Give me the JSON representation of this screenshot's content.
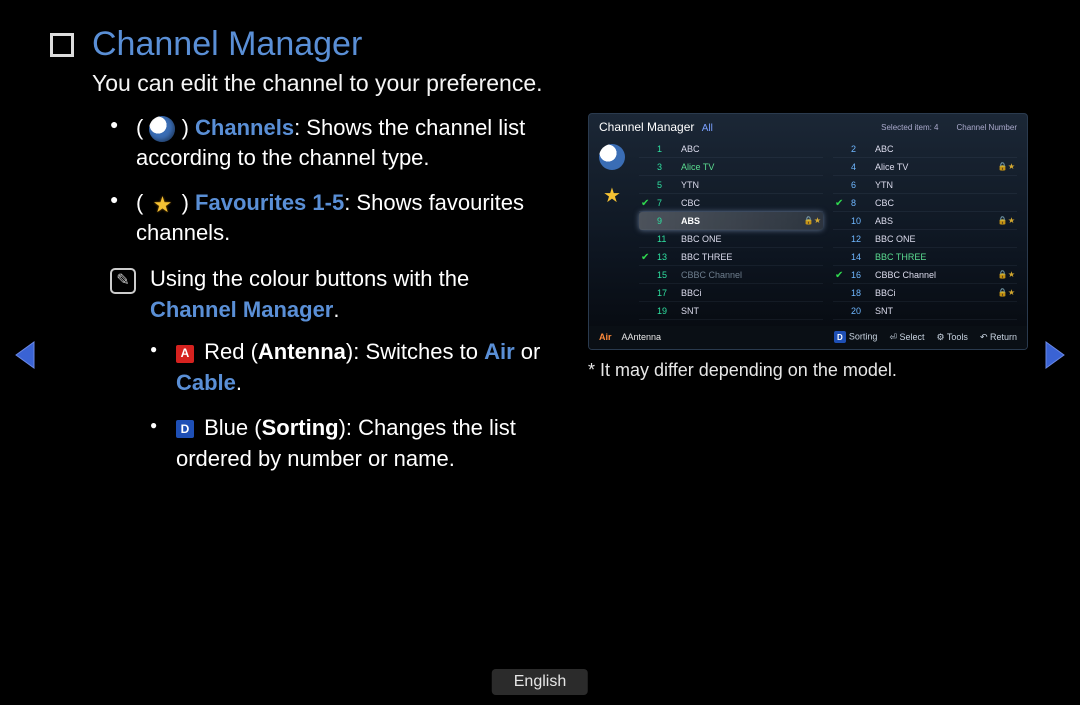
{
  "page": {
    "title": "Channel Manager",
    "subtitle": "You can edit the channel to your preference.",
    "language": "English"
  },
  "list": {
    "channels_label": "Channels",
    "channels_desc_before": "(",
    "channels_desc_after": "): Shows the channel list according to the channel type.",
    "favourites_label": "Favourites 1-5",
    "favourites_desc_before": "(",
    "favourites_desc_after": "): Shows favourites channels."
  },
  "note": {
    "intro": "Using the colour buttons with the ",
    "cm": "Channel Manager",
    "dot": ".",
    "red_key": "A",
    "red_pre": " Red (",
    "red_label": "Antenna",
    "red_mid": "): Switches to ",
    "red_air": "Air",
    "red_or": " or ",
    "red_cable": "Cable",
    "red_end": ".",
    "blue_key": "D",
    "blue_pre": " Blue (",
    "blue_label": "Sorting",
    "blue_after": "): Changes the list ordered by number or name."
  },
  "mini": {
    "title": "Channel Manager",
    "subtitle_all": "All",
    "selected_label": "Selected item: 4",
    "sort_label": "Channel Number",
    "left_rows": [
      {
        "n": "1",
        "name": "ABC",
        "chk": false,
        "lock": "",
        "dim": false
      },
      {
        "n": "3",
        "name": "Alice TV",
        "chk": false,
        "lock": "",
        "dim": false,
        "green": true
      },
      {
        "n": "5",
        "name": "YTN",
        "chk": false,
        "lock": "",
        "dim": false
      },
      {
        "n": "7",
        "name": "CBC",
        "chk": true,
        "lock": "",
        "dim": false
      },
      {
        "n": "9",
        "name": "ABS",
        "chk": false,
        "lock": "🔒★",
        "dim": false,
        "hl": true
      },
      {
        "n": "11",
        "name": "BBC ONE",
        "chk": false,
        "lock": "",
        "dim": false
      },
      {
        "n": "13",
        "name": "BBC THREE",
        "chk": true,
        "lock": "",
        "dim": false
      },
      {
        "n": "15",
        "name": "CBBC Channel",
        "chk": false,
        "lock": "",
        "dim": true
      },
      {
        "n": "17",
        "name": "BBCi",
        "chk": false,
        "lock": "",
        "dim": false
      },
      {
        "n": "19",
        "name": "SNT",
        "chk": false,
        "lock": "",
        "dim": false
      }
    ],
    "right_rows": [
      {
        "n": "2",
        "name": "ABC",
        "chk": false,
        "lock": "",
        "dim": false
      },
      {
        "n": "4",
        "name": "Alice TV",
        "chk": false,
        "lock": "🔒★",
        "dim": false
      },
      {
        "n": "6",
        "name": "YTN",
        "chk": false,
        "lock": "",
        "dim": false
      },
      {
        "n": "8",
        "name": "CBC",
        "chk": true,
        "lock": "",
        "dim": false
      },
      {
        "n": "10",
        "name": "ABS",
        "chk": false,
        "lock": "🔒★",
        "dim": false
      },
      {
        "n": "12",
        "name": "BBC ONE",
        "chk": false,
        "lock": "",
        "dim": false
      },
      {
        "n": "14",
        "name": "BBC THREE",
        "chk": false,
        "lock": "",
        "dim": true,
        "green": true
      },
      {
        "n": "16",
        "name": "CBBC Channel",
        "chk": true,
        "lock": "🔒★",
        "dim": false
      },
      {
        "n": "18",
        "name": "BBCi",
        "chk": false,
        "lock": "🔒★",
        "dim": false
      },
      {
        "n": "20",
        "name": "SNT",
        "chk": false,
        "lock": "",
        "dim": false
      }
    ],
    "footer": {
      "air": "Air",
      "antenna_key": "A",
      "antenna": "Antenna",
      "sorting_key": "D",
      "sorting": "Sorting",
      "select": "Select",
      "tools": "Tools",
      "return": "Return"
    }
  },
  "right_note": "* It may differ depending on the model."
}
